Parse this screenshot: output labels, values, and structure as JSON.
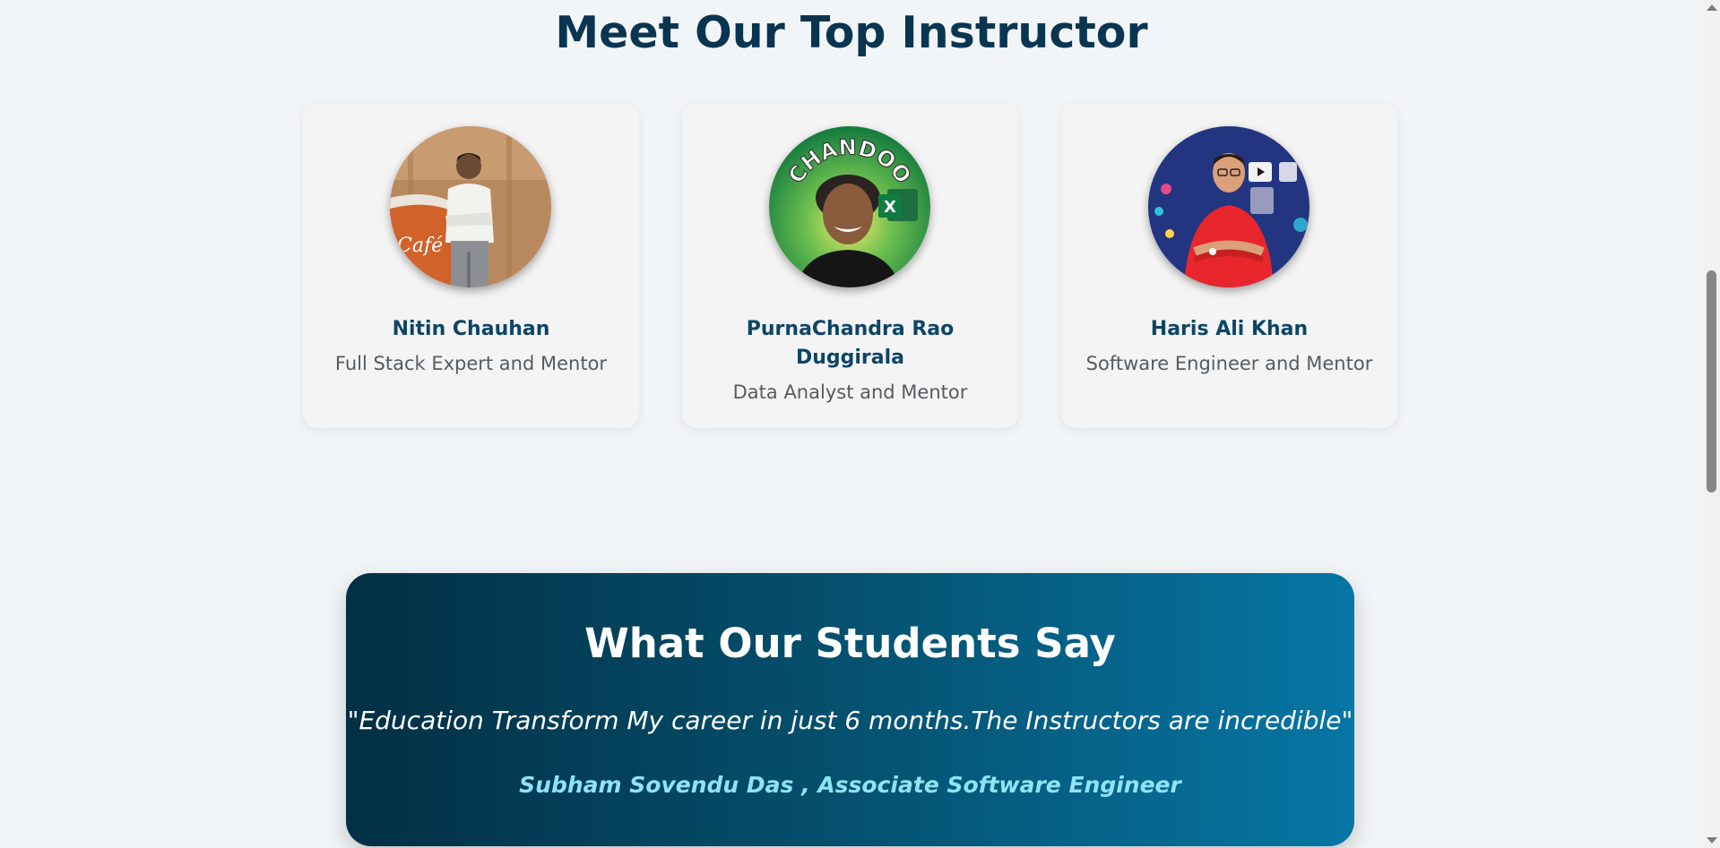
{
  "instructors_section": {
    "title": "Meet Our Top Instructor",
    "instructors": [
      {
        "name": "Nitin Chauhan",
        "role": "Full Stack Expert and Mentor"
      },
      {
        "name": "PurnaChandra Rao Duggirala",
        "role": "Data Analyst and Mentor",
        "photo_text": "CHANDOO",
        "photo_badge": "X"
      },
      {
        "name": "Haris Ali Khan",
        "role": "Software Engineer and Mentor"
      }
    ]
  },
  "testimonial": {
    "title": "What Our Students Say",
    "quote": "\"Education Transform My career in just 6 months.The Instructors are incredible\"",
    "author": "Subham Sovendu Das , Associate Software Engineer"
  },
  "colors": {
    "page_bg": "#f2f5f8",
    "heading": "#0a3550",
    "name": "#0d4566",
    "gradient_start": "#022f44",
    "gradient_end": "#0676a5",
    "author_accent": "#8fe3f5"
  }
}
